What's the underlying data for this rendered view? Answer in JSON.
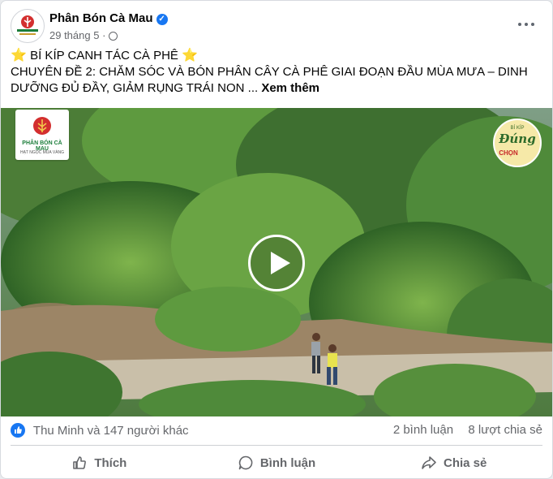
{
  "post": {
    "page_name": "Phân Bón Cà Mau",
    "date": "29 tháng 5",
    "dot": "·",
    "title_line": "BÍ KÍP CANH TÁC CÀ PHÊ",
    "body_line1": "CHUYÊN ĐỀ 2: CHĂM SÓC VÀ BÓN PHÂN CÂY CÀ PHÊ GIAI ĐOẠN ĐẦU MÙA MƯA – DINH",
    "body_line2": "DƯỠNG ĐỦ ĐẦY, GIẢM RỤNG TRÁI NON ...",
    "see_more": "Xem thêm",
    "star_icon": "⭐"
  },
  "video": {
    "logo_text": "PHÂN BÓN CÀ MAU",
    "logo_sub": "HẠT NGỌC MÙA VÀNG",
    "badge_text": "Đúng",
    "badge_sub": "CHỌN",
    "badge_top": "BÍ KÍP"
  },
  "stats": {
    "reactions": "Thu Minh và 147 người khác",
    "comments": "2 bình luận",
    "shares": "8 lượt chia sẻ"
  },
  "actions": {
    "like": "Thích",
    "comment": "Bình luận",
    "share": "Chia sẻ"
  },
  "colors": {
    "brand_blue": "#1877f2",
    "text_primary": "#050505",
    "text_secondary": "#65676b"
  }
}
